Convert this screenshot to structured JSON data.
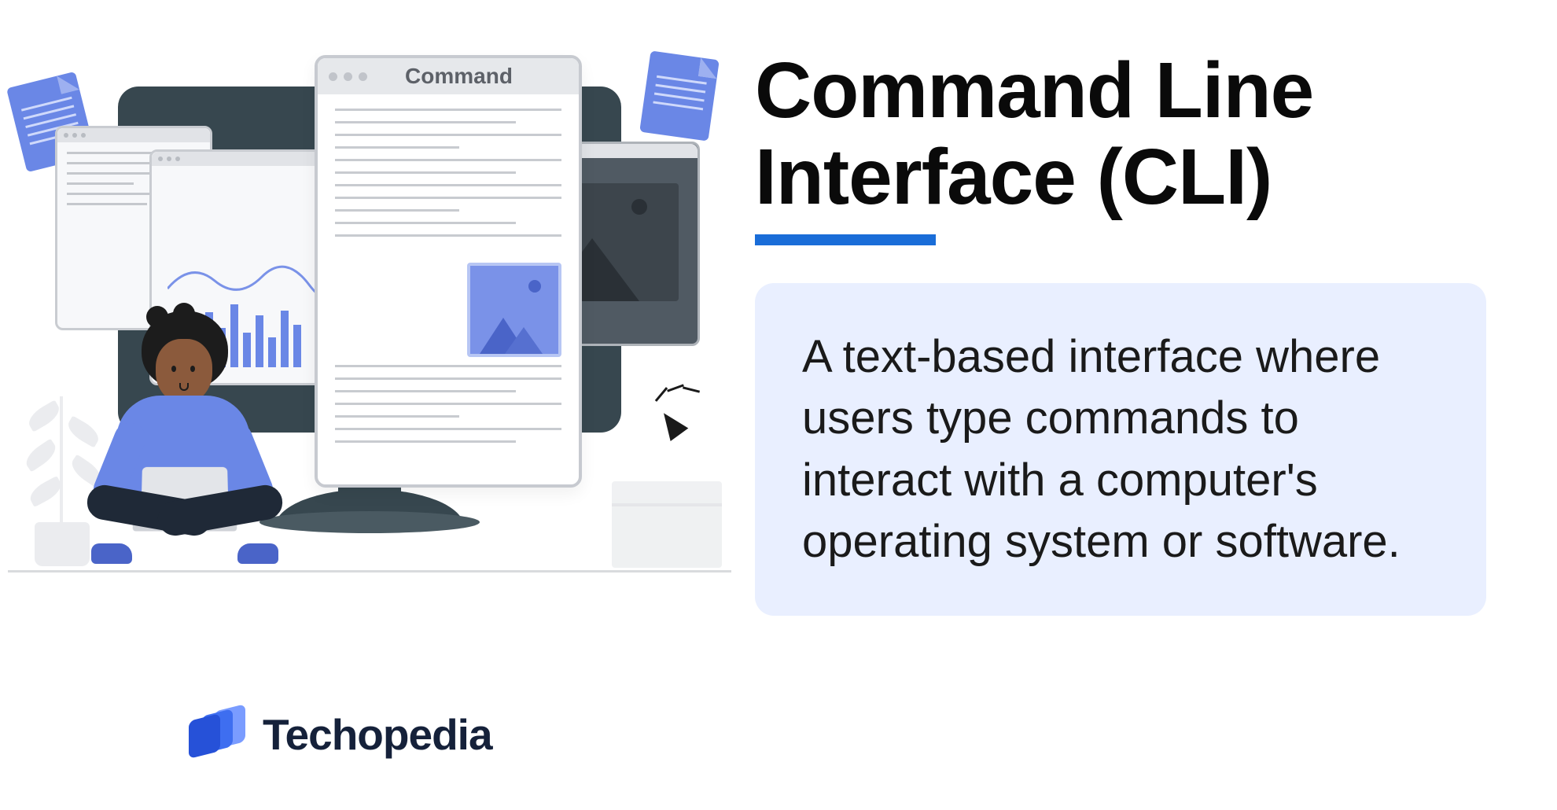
{
  "title": "Command Line Interface (CLI)",
  "definition": "A text-based interface where users type commands to interact with a computer's operating system or software.",
  "illustration": {
    "command_window_title": "Command"
  },
  "brand": {
    "name": "Techopedia"
  },
  "colors": {
    "accent": "#1a6dd8",
    "definition_bg": "#e9efff",
    "illustration_blue": "#6a87e6"
  }
}
